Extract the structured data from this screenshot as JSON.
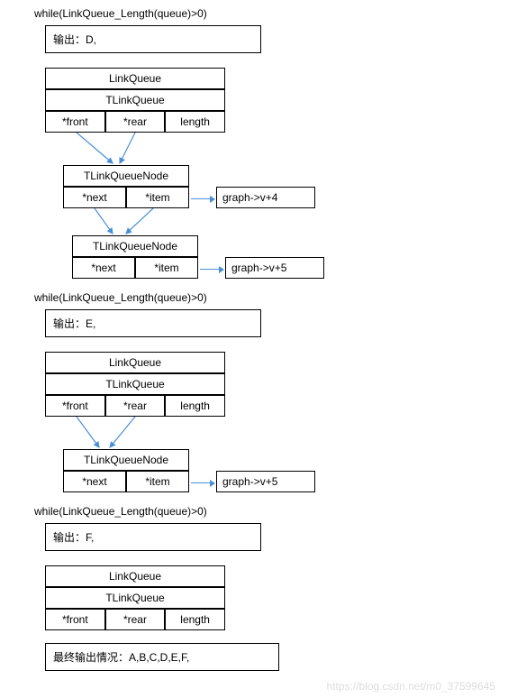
{
  "section1": {
    "code": "while(LinkQueue_Length(queue)>0)",
    "output": "输出：D,",
    "queue": {
      "title1": "LinkQueue",
      "title2": "TLinkQueue",
      "cols": [
        "*front",
        "*rear",
        "length"
      ]
    },
    "node1": {
      "title": "TLinkQueueNode",
      "cols": [
        "*next",
        "*item"
      ],
      "target": "graph->v+4"
    },
    "node2": {
      "title": "TLinkQueueNode",
      "cols": [
        "*next",
        "*item"
      ],
      "target": "graph->v+5"
    }
  },
  "section2": {
    "code": "while(LinkQueue_Length(queue)>0)",
    "output": "输出：E,",
    "queue": {
      "title1": "LinkQueue",
      "title2": "TLinkQueue",
      "cols": [
        "*front",
        "*rear",
        "length"
      ]
    },
    "node1": {
      "title": "TLinkQueueNode",
      "cols": [
        "*next",
        "*item"
      ],
      "target": "graph->v+5"
    }
  },
  "section3": {
    "code": "while(LinkQueue_Length(queue)>0)",
    "output": "输出：F,",
    "queue": {
      "title1": "LinkQueue",
      "title2": "TLinkQueue",
      "cols": [
        "*front",
        "*rear",
        "length"
      ]
    },
    "final": "最终输出情况：A,B,C,D,E,F,"
  },
  "watermark": "https://blog.csdn.net/m0_37599645"
}
